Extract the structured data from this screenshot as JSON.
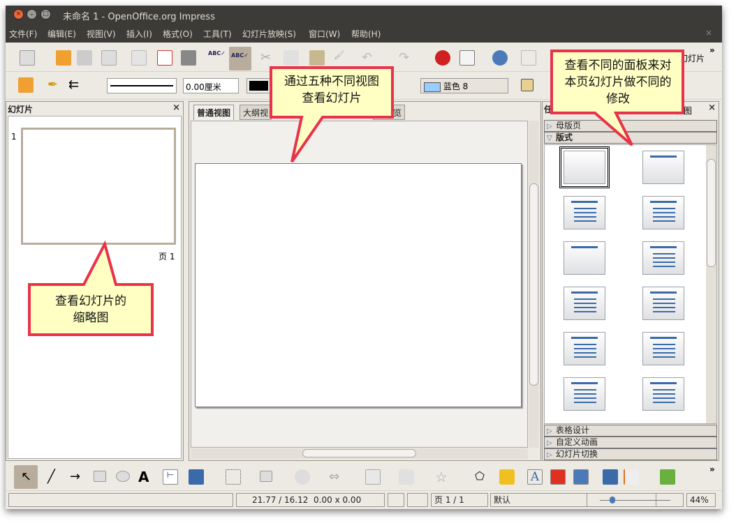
{
  "window": {
    "title": "未命名 1 - OpenOffice.org Impress"
  },
  "menu": [
    "文件(F)",
    "编辑(E)",
    "视图(V)",
    "插入(I)",
    "格式(O)",
    "工具(T)",
    "幻灯片放映(S)",
    "窗口(W)",
    "帮助(H)"
  ],
  "toolbar": {
    "slide_label": "幻灯片",
    "line_width": "0.00厘米",
    "area_color": "蓝色 8"
  },
  "slides_pane": {
    "title": "幻灯片",
    "slide_number": "1",
    "page_label": "页 1"
  },
  "view_tabs": [
    "普通视图",
    "大纲视",
    "片浏览"
  ],
  "tasks_pane": {
    "title": "任",
    "view_label": "视图",
    "sections": {
      "master": "母版页",
      "layouts": "版式",
      "table": "表格设计",
      "animation": "自定义动画",
      "transition": "幻灯片切换"
    },
    "layouts": [
      "blank",
      "title-only",
      "title-content",
      "title-2content",
      "title-only-bar",
      "centered-text",
      "title-box",
      "title-chart",
      "title-table",
      "title-clipart-text",
      "title-text-chart",
      "title-text-clipart"
    ]
  },
  "status": {
    "position": "21.77 / 16.12",
    "size": "0.00 x 0.00",
    "page": "页 1 / 1",
    "master": "默认",
    "zoom": "44%"
  },
  "callouts": {
    "views": "通过五种不同视图查看幻灯片",
    "panels": "查看不同的面板来对本页幻灯片做不同的修改",
    "thumbs": "查看幻灯片的缩略图"
  },
  "colors": {
    "callout_fill": "#ffffc4",
    "callout_border": "#e8334a",
    "titlebar": "#3c3b37"
  }
}
